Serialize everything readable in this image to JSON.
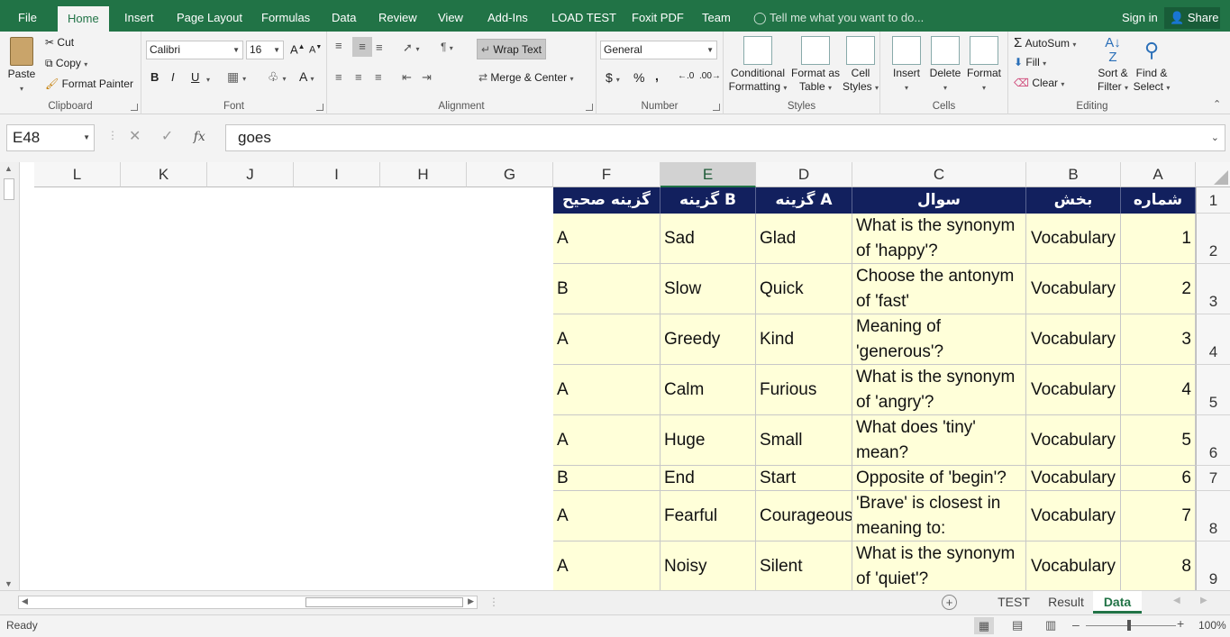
{
  "menu": {
    "tabs": [
      "File",
      "Home",
      "Insert",
      "Page Layout",
      "Formulas",
      "Data",
      "Review",
      "View",
      "Add-Ins",
      "LOAD TEST",
      "Foxit PDF",
      "Team"
    ],
    "tell_me": "Tell me what you want to do...",
    "sign_in": "Sign in",
    "share": "Share"
  },
  "ribbon": {
    "clipboard": {
      "paste": "Paste",
      "cut": "Cut",
      "copy": "Copy",
      "format_painter": "Format Painter",
      "label": "Clipboard"
    },
    "font": {
      "name": "Calibri",
      "size": "16",
      "bold": "B",
      "italic": "I",
      "underline": "U",
      "label": "Font"
    },
    "alignment": {
      "wrap_text": "Wrap Text",
      "merge_center": "Merge & Center",
      "label": "Alignment"
    },
    "number": {
      "format": "General",
      "currency": "$",
      "percent": "%",
      "comma": ",",
      "label": "Number"
    },
    "styles": {
      "conditional_1": "Conditional",
      "conditional_2": "Formatting",
      "format_table_1": "Format as",
      "format_table_2": "Table",
      "cell_styles_1": "Cell",
      "cell_styles_2": "Styles",
      "label": "Styles"
    },
    "cells": {
      "insert": "Insert",
      "delete": "Delete",
      "format": "Format",
      "label": "Cells"
    },
    "editing": {
      "autosum": "AutoSum",
      "fill": "Fill",
      "clear": "Clear",
      "sort_1": "Sort &",
      "sort_2": "Filter",
      "find_1": "Find &",
      "find_2": "Select",
      "label": "Editing"
    }
  },
  "formula_bar": {
    "name_box": "E48",
    "fx": "fx",
    "value": "goes"
  },
  "grid": {
    "columns": [
      "L",
      "K",
      "J",
      "I",
      "H",
      "G",
      "F",
      "E",
      "D",
      "C",
      "B",
      "A"
    ],
    "header_row": {
      "row": "1",
      "F": "گزینه صحیح",
      "E": "گزینه B",
      "D": "گزینه A",
      "C": "سوال",
      "B": "بخش",
      "A": "شماره"
    },
    "rows": [
      {
        "row": "2",
        "A": "1",
        "B": "Vocabulary",
        "C1": "What is the synonym",
        "C2": "of 'happy'?",
        "D": "Glad",
        "E": "Sad",
        "F": "A"
      },
      {
        "row": "3",
        "A": "2",
        "B": "Vocabulary",
        "C1": "Choose the antonym",
        "C2": "of 'fast'",
        "D": "Quick",
        "E": "Slow",
        "F": "B"
      },
      {
        "row": "4",
        "A": "3",
        "B": "Vocabulary",
        "C1": "Meaning of",
        "C2": "'generous'?",
        "D": "Kind",
        "E": "Greedy",
        "F": "A"
      },
      {
        "row": "5",
        "A": "4",
        "B": "Vocabulary",
        "C1": "What is the synonym",
        "C2": "of 'angry'?",
        "D": "Furious",
        "E": "Calm",
        "F": "A"
      },
      {
        "row": "6",
        "A": "5",
        "B": "Vocabulary",
        "C1": "What does 'tiny'",
        "C2": "mean?",
        "D": "Small",
        "E": "Huge",
        "F": "A"
      },
      {
        "row": "7",
        "A": "6",
        "B": "Vocabulary",
        "C1": "Opposite of 'begin'?",
        "C2": "",
        "D": "Start",
        "E": "End",
        "F": "B"
      },
      {
        "row": "8",
        "A": "7",
        "B": "Vocabulary",
        "C1": "'Brave' is closest in",
        "C2": "meaning to:",
        "D": "Courageous",
        "E": "Fearful",
        "F": "A"
      },
      {
        "row": "9",
        "A": "8",
        "B": "Vocabulary",
        "C1": "What is the synonym",
        "C2": "of 'quiet'?",
        "D": "Silent",
        "E": "Noisy",
        "F": "A"
      }
    ]
  },
  "sheets": [
    "TEST",
    "Result",
    "Data"
  ],
  "status": {
    "ready": "Ready",
    "zoom": "100%"
  },
  "colors": {
    "excel_green": "#217346",
    "header_navy": "#12205e",
    "cell_yellow": "#ffffd9"
  }
}
